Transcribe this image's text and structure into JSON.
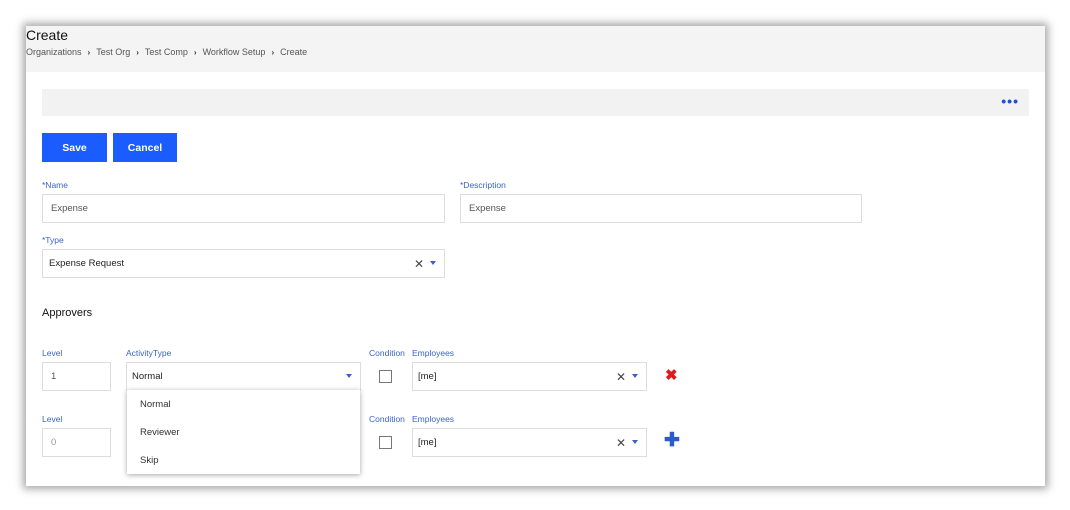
{
  "header": {
    "title": "Create",
    "breadcrumb": [
      "Organizations",
      "Test Org",
      "Test Comp",
      "Workflow Setup",
      "Create"
    ]
  },
  "toolbar": {
    "more_icon": "more-dots-icon"
  },
  "actions": {
    "save_label": "Save",
    "cancel_label": "Cancel"
  },
  "form": {
    "name": {
      "label": "*Name",
      "value": "Expense"
    },
    "description": {
      "label": "*Description",
      "value": "Expense"
    },
    "type": {
      "label": "*Type",
      "value": "Expense Request"
    }
  },
  "approvers": {
    "title": "Approvers",
    "rows": [
      {
        "level_label": "Level",
        "level_value": "1",
        "activity_label": "ActivityType",
        "activity_value": "Normal",
        "condition_label": "Condition",
        "employees_label": "Employees",
        "employees_value": "[me]",
        "action_icon": "remove-icon"
      },
      {
        "level_label": "Level",
        "level_value": "0",
        "condition_label": "Condition",
        "employees_label": "Employees",
        "employees_value": "[me]",
        "action_icon": "add-icon"
      }
    ]
  },
  "activity_dropdown": {
    "options": [
      "Normal",
      "Reviewer",
      "Skip"
    ]
  },
  "colors": {
    "accent": "#1b5cff",
    "label": "#3a62c9",
    "remove": "#e01b1b"
  }
}
